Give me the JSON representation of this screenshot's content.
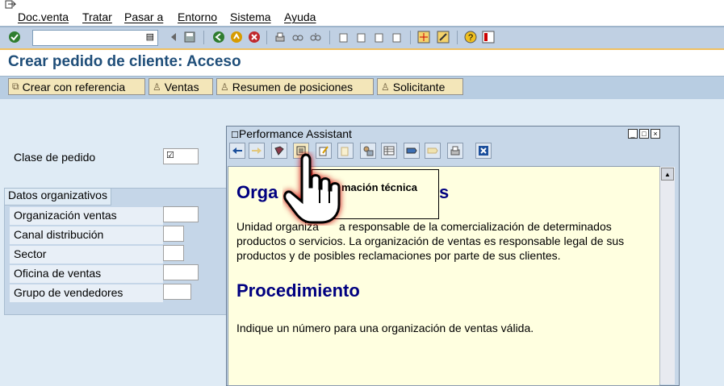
{
  "menu": {
    "items": [
      "Doc.venta",
      "Tratar",
      "Pasar a",
      "Entorno",
      "Sistema",
      "Ayuda"
    ]
  },
  "toolbar": {
    "command_field_value": "",
    "icons": [
      "enter-icon",
      "dropdown-icon",
      "back-icon",
      "save-icon",
      "green-back-icon",
      "exit-icon",
      "cancel-icon",
      "print-icon",
      "find-icon",
      "find-next-icon",
      "first-page-icon",
      "prev-page-icon",
      "next-page-icon",
      "last-page-icon",
      "new-session-icon",
      "shortcut-icon",
      "help-icon",
      "layout-icon"
    ]
  },
  "page": {
    "title": "Crear pedido de cliente: Acceso"
  },
  "app_toolbar": {
    "buttons": [
      "Crear con referencia",
      "Ventas",
      "Resumen de posiciones",
      "Solicitante"
    ]
  },
  "form": {
    "clase_label": "Clase de pedido",
    "group_title": "Datos organizativos",
    "fields": [
      "Organización ventas",
      "Canal distribución",
      "Sector",
      "Oficina de ventas",
      "Grupo de vendedores"
    ]
  },
  "performance_assistant": {
    "title": "Performance Assistant",
    "tooltip": "mación técnica",
    "heading1": "Orga",
    "heading1_tail": "s",
    "para1_line1": "Unidad organiza",
    "para1_line1_tail": "a responsable de la comercialización de determinados",
    "para1_line2": "productos o servicios. La organización de ventas es responsable legal de sus",
    "para1_line3": "productos y de posibles reclamaciones por parte de sus clientes.",
    "heading2": "Procedimiento",
    "para2": "Indique un número para una organización de ventas válida."
  },
  "colors": {
    "title": "#1f4e79",
    "heading": "#000080",
    "button_bg": "#f3e6b9",
    "pa_content_bg": "#ffffe0"
  }
}
